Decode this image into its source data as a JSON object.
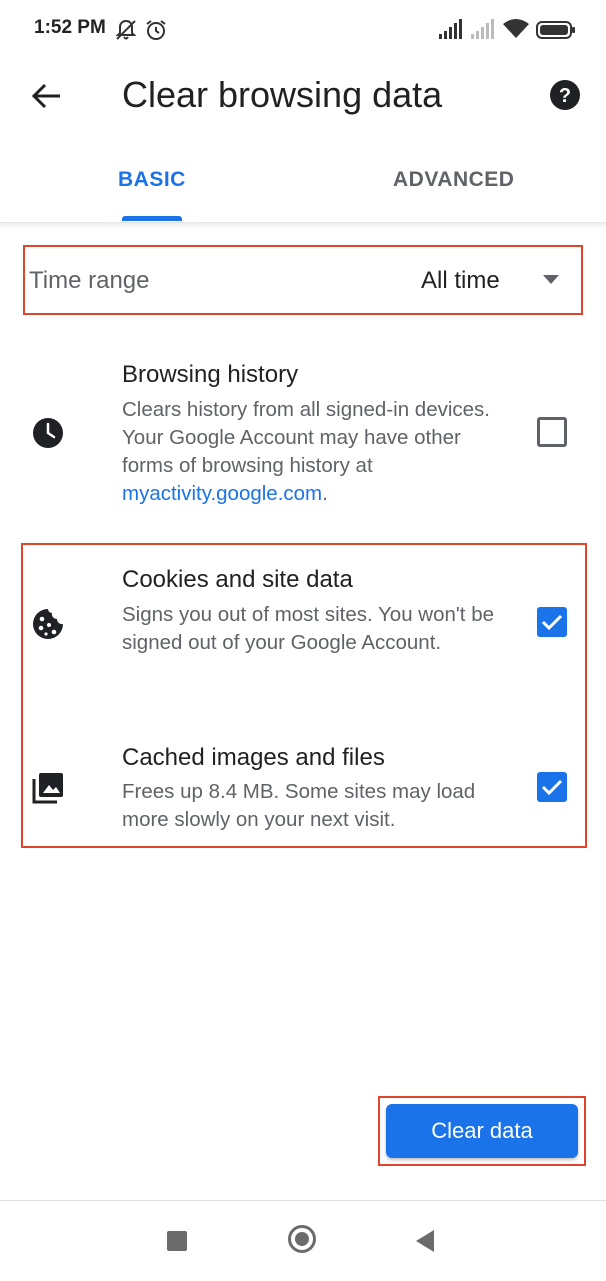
{
  "status_bar": {
    "time": "1:52 PM",
    "icons": [
      "notifications-off-icon",
      "alarm-icon",
      "signal-icon",
      "signal-weak-icon",
      "wifi-icon",
      "battery-icon"
    ]
  },
  "app_bar": {
    "title": "Clear browsing data",
    "back_icon": "arrow-back-icon",
    "help_icon": "help-icon"
  },
  "tabs": [
    {
      "label": "BASIC",
      "selected": true
    },
    {
      "label": "ADVANCED",
      "selected": false
    }
  ],
  "time_range": {
    "label": "Time range",
    "value": "All time"
  },
  "options": [
    {
      "title": "Browsing history",
      "description": "Clears history from all signed-in devices. Your Google Account may have other forms of browsing history at ",
      "link": "myactivity.google.com",
      "description_end": ".",
      "icon": "clock-icon",
      "checked": false
    },
    {
      "title": "Cookies and site data",
      "description": "Signs you out of most sites. You won't be signed out of your Google Account.",
      "icon": "cookie-icon",
      "checked": true
    },
    {
      "title": "Cached images and files",
      "description": "Frees up 8.4 MB. Some sites may load more slowly on your next visit.",
      "icon": "images-icon",
      "checked": true
    }
  ],
  "action": {
    "clear_label": "Clear data"
  },
  "colors": {
    "accent": "#1a73e8",
    "highlight_border": "#e0442a",
    "secondary_text": "#5f6368"
  }
}
